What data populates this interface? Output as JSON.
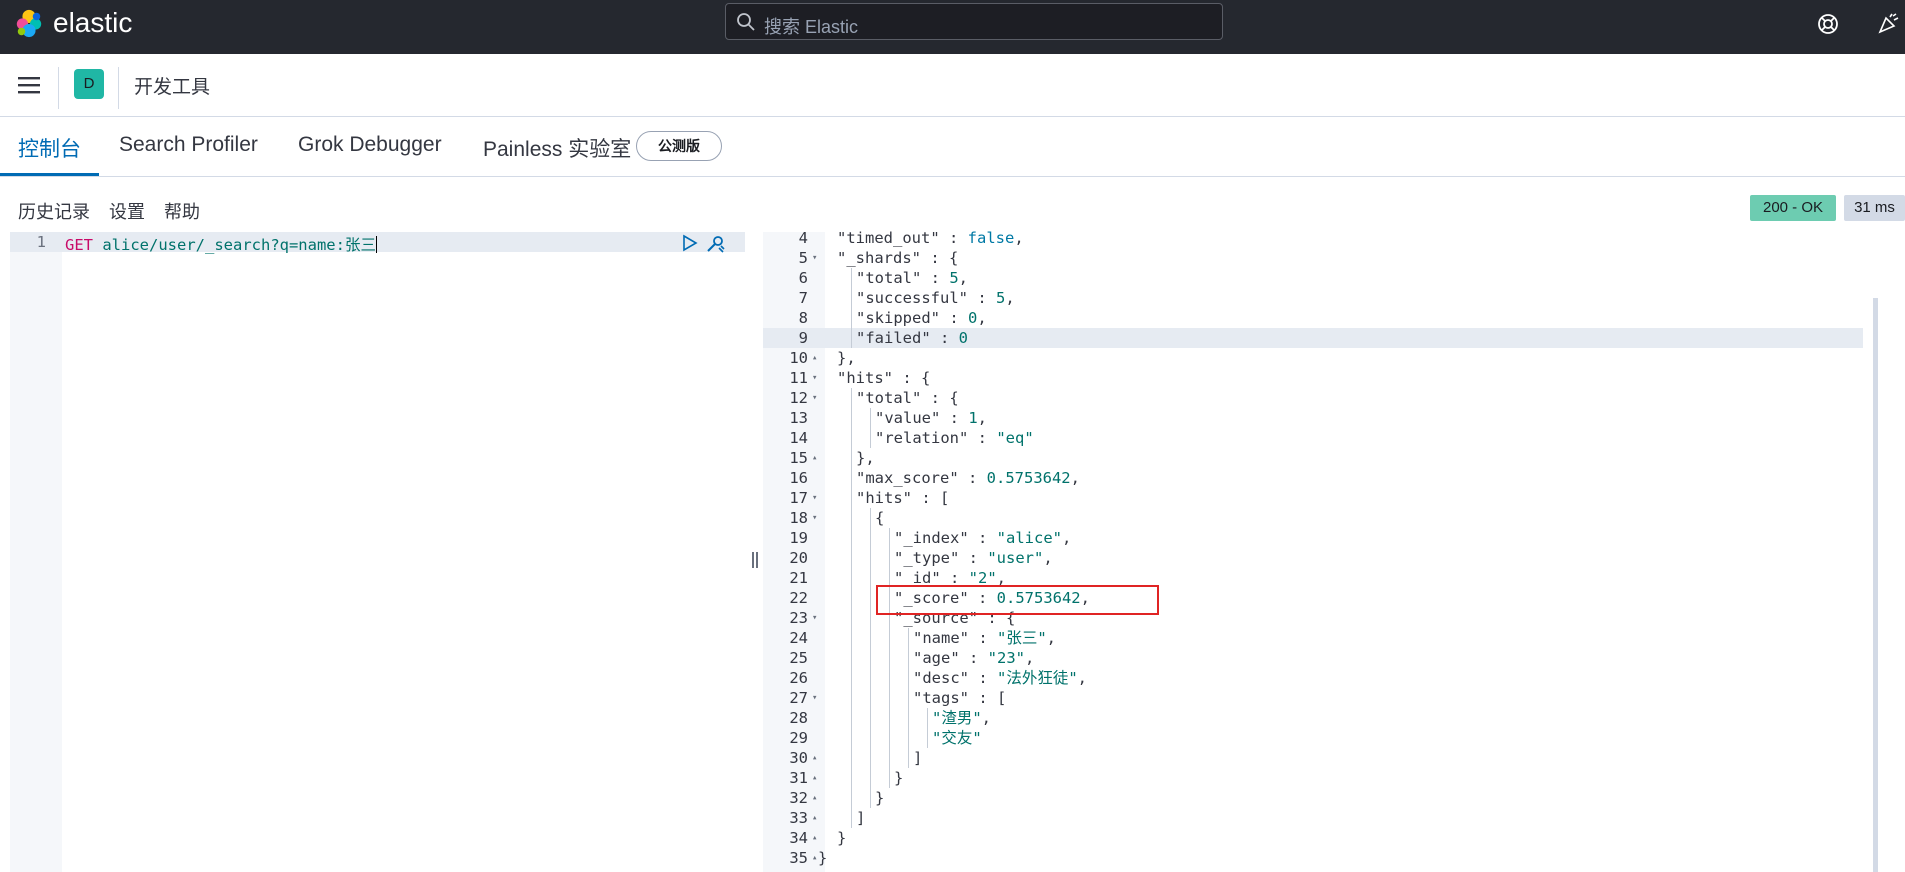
{
  "app": {
    "brand": "elastic"
  },
  "search": {
    "placeholder": "搜索 Elastic"
  },
  "header_icons": [
    "help-lifebuoy-icon",
    "newsfeed-icon"
  ],
  "breadcrumb": {
    "space_initial": "D",
    "title": "开发工具"
  },
  "tabs": [
    {
      "label": "控制台",
      "active": true
    },
    {
      "label": "Search Profiler",
      "active": false
    },
    {
      "label": "Grok Debugger",
      "active": false
    },
    {
      "label": "Painless 实验室",
      "active": false
    }
  ],
  "beta_badge": "公测版",
  "toolbar": {
    "history": "历史记录",
    "settings": "设置",
    "help": "帮助"
  },
  "status": {
    "code": "200 - OK",
    "time": "31 ms"
  },
  "request": {
    "line_number": "1",
    "method": "GET",
    "path": "alice/user/_search?q=name:张三"
  },
  "response_lines": [
    {
      "n": "4",
      "fold": "",
      "indent": 1,
      "key": "\"timed_out\"",
      "sep": " : ",
      "val": "false",
      "vt": "b",
      "tail": ","
    },
    {
      "n": "5",
      "fold": "▾",
      "indent": 1,
      "key": "\"_shards\"",
      "sep": " : ",
      "val": "",
      "vt": "",
      "tail": "{"
    },
    {
      "n": "6",
      "fold": "",
      "indent": 2,
      "key": "\"total\"",
      "sep": " : ",
      "val": "5",
      "vt": "n",
      "tail": ","
    },
    {
      "n": "7",
      "fold": "",
      "indent": 2,
      "key": "\"successful\"",
      "sep": " : ",
      "val": "5",
      "vt": "n",
      "tail": ","
    },
    {
      "n": "8",
      "fold": "",
      "indent": 2,
      "key": "\"skipped\"",
      "sep": " : ",
      "val": "0",
      "vt": "n",
      "tail": ","
    },
    {
      "n": "9",
      "fold": "",
      "indent": 2,
      "key": "\"failed\"",
      "sep": " : ",
      "val": "0",
      "vt": "n",
      "tail": ""
    },
    {
      "n": "10",
      "fold": "▴",
      "indent": 1,
      "key": "",
      "sep": "",
      "val": "",
      "vt": "",
      "tail": "},"
    },
    {
      "n": "11",
      "fold": "▾",
      "indent": 1,
      "key": "\"hits\"",
      "sep": " : ",
      "val": "",
      "vt": "",
      "tail": "{"
    },
    {
      "n": "12",
      "fold": "▾",
      "indent": 2,
      "key": "\"total\"",
      "sep": " : ",
      "val": "",
      "vt": "",
      "tail": "{"
    },
    {
      "n": "13",
      "fold": "",
      "indent": 3,
      "key": "\"value\"",
      "sep": " : ",
      "val": "1",
      "vt": "n",
      "tail": ","
    },
    {
      "n": "14",
      "fold": "",
      "indent": 3,
      "key": "\"relation\"",
      "sep": " : ",
      "val": "\"eq\"",
      "vt": "s",
      "tail": ""
    },
    {
      "n": "15",
      "fold": "▴",
      "indent": 2,
      "key": "",
      "sep": "",
      "val": "",
      "vt": "",
      "tail": "},"
    },
    {
      "n": "16",
      "fold": "",
      "indent": 2,
      "key": "\"max_score\"",
      "sep": " : ",
      "val": "0.5753642",
      "vt": "n",
      "tail": ","
    },
    {
      "n": "17",
      "fold": "▾",
      "indent": 2,
      "key": "\"hits\"",
      "sep": " : ",
      "val": "",
      "vt": "",
      "tail": "["
    },
    {
      "n": "18",
      "fold": "▾",
      "indent": 3,
      "key": "",
      "sep": "",
      "val": "",
      "vt": "",
      "tail": "{"
    },
    {
      "n": "19",
      "fold": "",
      "indent": 4,
      "key": "\"_index\"",
      "sep": " : ",
      "val": "\"alice\"",
      "vt": "s",
      "tail": ","
    },
    {
      "n": "20",
      "fold": "",
      "indent": 4,
      "key": "\"_type\"",
      "sep": " : ",
      "val": "\"user\"",
      "vt": "s",
      "tail": ","
    },
    {
      "n": "21",
      "fold": "",
      "indent": 4,
      "key": "\"_id\"",
      "sep": " : ",
      "val": "\"2\"",
      "vt": "s",
      "tail": ","
    },
    {
      "n": "22",
      "fold": "",
      "indent": 4,
      "key": "\"_score\"",
      "sep": " : ",
      "val": "0.5753642",
      "vt": "n",
      "tail": ","
    },
    {
      "n": "23",
      "fold": "▾",
      "indent": 4,
      "key": "\"_source\"",
      "sep": " : ",
      "val": "",
      "vt": "",
      "tail": "{"
    },
    {
      "n": "24",
      "fold": "",
      "indent": 5,
      "key": "\"name\"",
      "sep": " : ",
      "val": "\"张三\"",
      "vt": "s",
      "tail": ","
    },
    {
      "n": "25",
      "fold": "",
      "indent": 5,
      "key": "\"age\"",
      "sep": " : ",
      "val": "\"23\"",
      "vt": "s",
      "tail": ","
    },
    {
      "n": "26",
      "fold": "",
      "indent": 5,
      "key": "\"desc\"",
      "sep": " : ",
      "val": "\"法外狂徒\"",
      "vt": "s",
      "tail": ","
    },
    {
      "n": "27",
      "fold": "▾",
      "indent": 5,
      "key": "\"tags\"",
      "sep": " : ",
      "val": "",
      "vt": "",
      "tail": "["
    },
    {
      "n": "28",
      "fold": "",
      "indent": 6,
      "key": "",
      "sep": "",
      "val": "\"渣男\"",
      "vt": "s",
      "tail": ","
    },
    {
      "n": "29",
      "fold": "",
      "indent": 6,
      "key": "",
      "sep": "",
      "val": "\"交友\"",
      "vt": "s",
      "tail": ""
    },
    {
      "n": "30",
      "fold": "▴",
      "indent": 5,
      "key": "",
      "sep": "",
      "val": "",
      "vt": "",
      "tail": "]"
    },
    {
      "n": "31",
      "fold": "▴",
      "indent": 4,
      "key": "",
      "sep": "",
      "val": "",
      "vt": "",
      "tail": "}"
    },
    {
      "n": "32",
      "fold": "▴",
      "indent": 3,
      "key": "",
      "sep": "",
      "val": "",
      "vt": "",
      "tail": "}"
    },
    {
      "n": "33",
      "fold": "▴",
      "indent": 2,
      "key": "",
      "sep": "",
      "val": "",
      "vt": "",
      "tail": "]"
    },
    {
      "n": "34",
      "fold": "▴",
      "indent": 1,
      "key": "",
      "sep": "",
      "val": "",
      "vt": "",
      "tail": "}"
    },
    {
      "n": "35",
      "fold": "▴",
      "indent": 0,
      "key": "",
      "sep": "",
      "val": "",
      "vt": "",
      "tail": "}"
    }
  ],
  "colors": {
    "header_bg": "#25282f",
    "accent": "#006bb4",
    "space_badge": "#20b7a5",
    "status_ok": "#6dccb1",
    "highlight_box": "#e02424"
  }
}
